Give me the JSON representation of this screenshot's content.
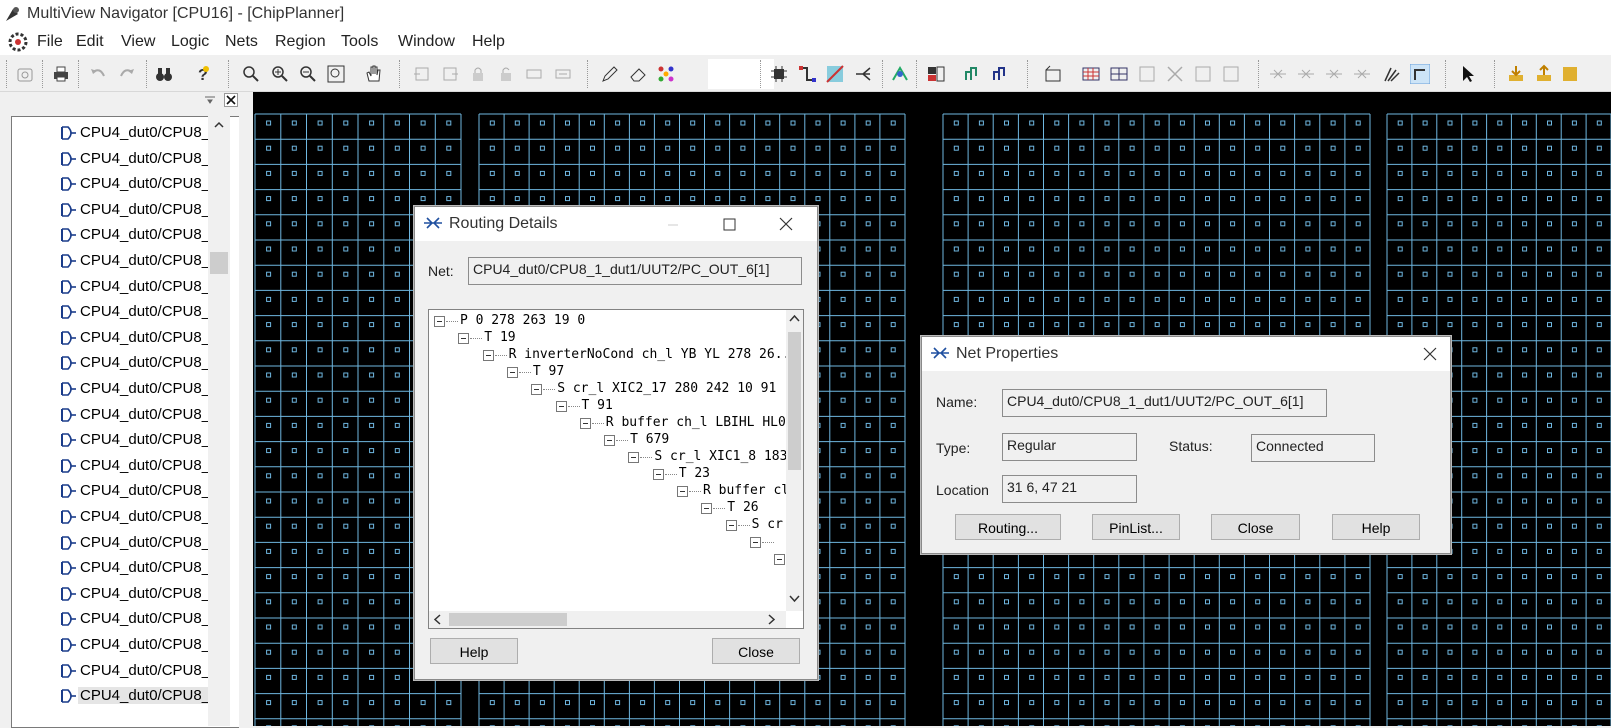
{
  "window": {
    "title": "MultiView Navigator [CPU16] - [ChipPlanner]"
  },
  "menu": [
    "File",
    "Edit",
    "View",
    "Logic",
    "Nets",
    "Region",
    "Tools",
    "Window",
    "Help"
  ],
  "left_panel": {
    "items": [
      "CPU4_dut0/CPU8_",
      "CPU4_dut0/CPU8_",
      "CPU4_dut0/CPU8_",
      "CPU4_dut0/CPU8_",
      "CPU4_dut0/CPU8_",
      "CPU4_dut0/CPU8_",
      "CPU4_dut0/CPU8_",
      "CPU4_dut0/CPU8_",
      "CPU4_dut0/CPU8_",
      "CPU4_dut0/CPU8_",
      "CPU4_dut0/CPU8_",
      "CPU4_dut0/CPU8_",
      "CPU4_dut0/CPU8_",
      "CPU4_dut0/CPU8_",
      "CPU4_dut0/CPU8_",
      "CPU4_dut0/CPU8_",
      "CPU4_dut0/CPU8_",
      "CPU4_dut0/CPU8_",
      "CPU4_dut0/CPU8_",
      "CPU4_dut0/CPU8_",
      "CPU4_dut0/CPU8_",
      "CPU4_dut0/CPU8_",
      "CPU4_dut0/CPU8_"
    ],
    "selected_index": 22
  },
  "routing_details": {
    "title": "Routing Details",
    "net_label": "Net:",
    "net_value": "CPU4_dut0/CPU8_1_dut1/UUT2/PC_OUT_6[1]",
    "tree": [
      "P 0 278 263 19 0",
      "T 19",
      "R inverterNoCond ch_l YB YL 278 26...",
      "T 97",
      "S cr_l XIC2_17 280 242 10 91",
      "T 91",
      "R buffer ch_l LBIHL HL0",
      "T 679",
      "S cr_l XIC1_8 183",
      "T 23",
      "R buffer cl",
      "T 26",
      "S cr",
      "",
      ""
    ],
    "help_label": "Help",
    "close_label": "Close"
  },
  "net_properties": {
    "title": "Net Properties",
    "name_label": "Name:",
    "name_value": "CPU4_dut0/CPU8_1_dut1/UUT2/PC_OUT_6[1]",
    "type_label": "Type:",
    "type_value": "Regular",
    "status_label": "Status:",
    "status_value": "Connected",
    "location_label": "Location",
    "location_value": "31 6, 47 21",
    "buttons": [
      "Routing...",
      "PinList...",
      "Close",
      "Help"
    ]
  },
  "colors": {
    "grid_line": "#6fb7e0",
    "canvas_bg": "#000000",
    "dialog_bg": "#f0f0f0"
  }
}
